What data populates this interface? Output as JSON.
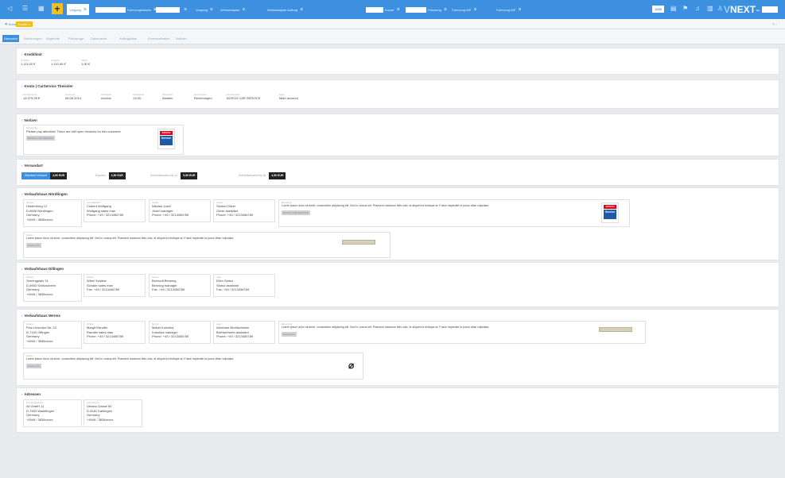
{
  "topbar": {
    "tabs": [
      {
        "label": "Vorgang",
        "active": true
      },
      {
        "label": "Fahrzeughistorie"
      },
      {
        "label": ""
      },
      {
        "label": "Vorgang"
      },
      {
        "label": "Werkstattplan"
      },
      {
        "label": "Werkstattplan Auftrag"
      },
      {
        "label": "Kunde"
      },
      {
        "label": "Fahrzeug"
      },
      {
        "label": "Fahrzeug WE"
      },
      {
        "label": "Fahrzeug WE"
      }
    ],
    "count_badge": "1200",
    "logo_main": "NEXT",
    "logo_accent": "V",
    "logo_suffix": "™"
  },
  "subbar": {
    "tag1": "Kunde",
    "tag2": "Kunde"
  },
  "record_tabs": [
    "Übersicht",
    "Rechnungen",
    "Angebote",
    "Fahrzeuge",
    "Dokumente",
    "Auftragsliste",
    "Kommunikation",
    "Notizen"
  ],
  "sections": {
    "kreditlimit": {
      "title": "Kreditlimit",
      "fields": [
        {
          "label": "Kreditlimit",
          "value": "1.111,00 €"
        },
        {
          "label": "Verfügbar",
          "value": "1.110,00 €"
        },
        {
          "label": "Offener",
          "value": "1,00 €"
        }
      ]
    },
    "konto": {
      "title": "Konto | CarService Theissler",
      "fields": [
        {
          "label": "Kundennummer",
          "value": "14.979,99 €"
        },
        {
          "label": "Kunde seit",
          "value": "08.08.2014"
        },
        {
          "label": "Zahlungsart",
          "value": "Invoice"
        },
        {
          "label": "Zahlungsziel",
          "value": "13,90 -"
        },
        {
          "label": "Zahlungsart",
          "value": "Abstein"
        },
        {
          "label": "Rechnungsart",
          "value": "Rechnungen"
        },
        {
          "label": "Kundengruppe",
          "value": "BOSCH CAR SERVICE"
        },
        {
          "label": "Konto",
          "value": "Main account"
        }
      ]
    },
    "notizen": {
      "title": "Notizen",
      "note_label": "Kundennotiz",
      "note_text": "Please pay attention! There are still open invoices for this customer",
      "note_tag": "BOSCH CAR SERVICE",
      "logo_top": "BOSCH",
      "logo_bottom": "Service"
    },
    "versandart": {
      "title": "Versandart",
      "pills": [
        {
          "label": "Standard Versand",
          "value": "4,90 EUR"
        },
        {
          "label": "Express",
          "value": "2,50 EUR"
        },
        {
          "label": "Schnellversand bis 12",
          "value": "5,90 EUR"
        },
        {
          "label": "Schnellversand bis 15",
          "value": "4,50 EUR"
        }
      ]
    },
    "nordlingen": {
      "title": "Verkaufshaus Nördlingen",
      "address_label": "Adresse",
      "address": [
        "Hindenburg 12",
        "D-8636 Nördlingen",
        "Germany",
        "+4949 / 3838xxxxx"
      ],
      "contacts": [
        {
          "label": "Geschäftsführer",
          "lines": [
            "Colbert Wolfgang",
            "Wolfgang sales man",
            "Phone: +49 / 3213456789"
          ]
        },
        {
          "label": "Verkauf",
          "lines": [
            "Nikolas Josef",
            "Josef manager",
            "Phone: +49 / 3213456789"
          ]
        },
        {
          "label": "Service",
          "lines": [
            "Strobel Oliver",
            "Oliver assistant",
            "Phone: +49 / 3213456789"
          ]
        }
      ],
      "remark_label": "Bemerkung",
      "remark": "Lorem ipsum dolor sit amet, consectetur adipiscing elit. Sed in cursus elit. Praesent maximus felis odio, et aliquet ex tristique at. Fusce imperdiet id purus vitae vulputate.",
      "remark_tag": "BOSCH CAR SERVICE",
      "note_label": "Notizen",
      "note": "Lorem ipsum dolor sit amet, consectetur adipiscing elit. Sed in cursus elit. Praesent maximus felis odio, et aliquet ex tristique at. Fusce imperdiet id purus vitae vulputate.",
      "note_tag": "Kunde Info",
      "logo_top": "BOSCH",
      "logo_bottom": "Service"
    },
    "dillingen": {
      "title": "Verkaufshaus Dillingen",
      "address_label": "Adresse",
      "address": [
        "Seeringplatz 31",
        "D-8934 Schlossheim",
        "Germany",
        "+4949 / 3838xxxxx"
      ],
      "contacts": [
        {
          "label": "Verkauf",
          "lines": [
            "Wibel Schäde",
            "Schäde sales man",
            "Fax: +49 / 3213456789"
          ]
        },
        {
          "label": "Service",
          "lines": [
            "Bennedi Benning",
            "Benning manager",
            "Fax: +49 / 3213456789"
          ]
        },
        {
          "label": "Lager",
          "lines": [
            "Ellen Strasz",
            "Strasz assistant",
            "Fax: +49 / 3213456789"
          ]
        }
      ]
    },
    "werms": {
      "title": "Verkaufshaus Werms",
      "address_label": "Adresse",
      "address": [
        "Pelz-Lieschke-Str. 23",
        "D-7163 Offingen",
        "Germany",
        "+4949 / 3838xxxxx"
      ],
      "contacts": [
        {
          "label": "Verkauf",
          "lines": [
            "Margit Randler",
            "Randler sales man",
            "Phone: +49 / 3213456789"
          ]
        },
        {
          "label": "Service",
          "lines": [
            "Mabel Kokolina",
            "Kokolina manager",
            "Phone: +49 / 3213456789"
          ]
        },
        {
          "label": "Lager",
          "lines": [
            "Abraham Brühlschwein",
            "Brühlschwein assistant",
            "Phone: +49 / 3213456789"
          ]
        }
      ],
      "remark_label": "Bemerkung",
      "remark": "Lorem ipsum dolor sit amet, consectetur adipiscing elit. Sed in cursus elit. Praesent maximus felis odio, et aliquet ex tristique at. Fusce imperdiet id purus vitae vulputate.",
      "remark_tag": "Kunde Info",
      "note_label": "Notizen",
      "note": "Lorem ipsum dolor sit amet, consectetur adipiscing elit. Sed in cursus elit. Praesent maximus felis odio, et aliquet ex tristique at. Fusce imperdiet id purus vitae vulputate.",
      "note_tag": "Kunde Info"
    },
    "adressen": {
      "title": "Adressen",
      "addresses": [
        {
          "label": "Rechnungsadresse",
          "lines": [
            "Ali GmbH 11",
            "D-7633 Wadelingen",
            "Germany",
            "+4949 / 3838xxxxx"
          ]
        },
        {
          "label": "Lieferadresse",
          "lines": [
            "Urbanz-Gasse 53",
            "D-8181 Kahlingen",
            "Germany",
            "+4949 / 3838xxxxx"
          ]
        }
      ]
    }
  },
  "colors": {
    "accent": "#3d8fe0",
    "topbar": "#3d8fe0",
    "plus": "#f0c020",
    "bosch_red": "#e2001a",
    "bosch_blue": "#1f5aa6"
  }
}
